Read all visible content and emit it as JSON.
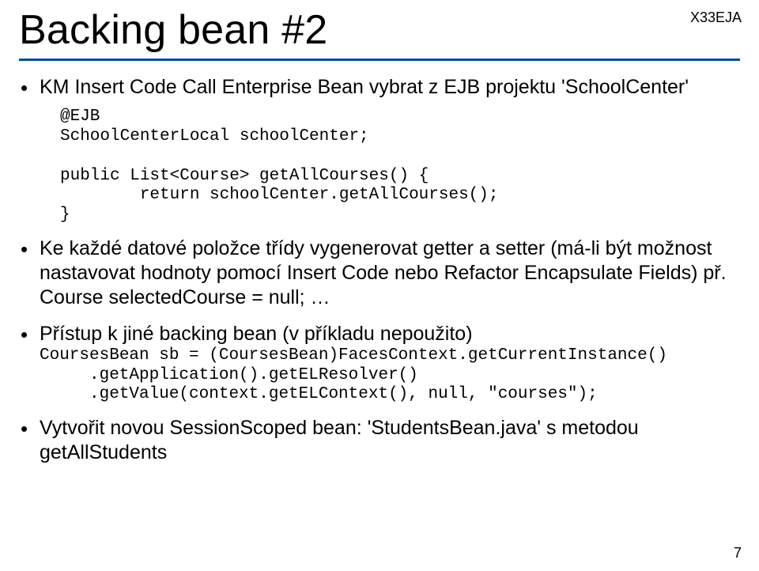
{
  "tag": "X33EJA",
  "title": "Backing bean #2",
  "page_number": "7",
  "bullets": {
    "b1": {
      "text": "KM Insert Code Call Enterprise Bean vybrat z EJB projektu 'SchoolCenter'",
      "code": "@EJB\nSchoolCenterLocal schoolCenter;\n\npublic List<Course> getAllCourses() {\n        return schoolCenter.getAllCourses();\n}"
    },
    "b2": {
      "text": "Ke každé datové položce třídy vygenerovat getter a setter (má-li být možnost nastavovat hodnoty pomocí Insert Code nebo Refactor Encapsulate Fields) př. Course selectedCourse = null; …"
    },
    "b3": {
      "text": "Přístup k jiné backing bean (v příkladu nepoužito)",
      "code": "CoursesBean sb = (CoursesBean)FacesContext.getCurrentInstance()\n     .getApplication().getELResolver()\n     .getValue(context.getELContext(), null, \"courses\");"
    },
    "b4": {
      "text": "Vytvořit novou SessionScoped bean: 'StudentsBean.java' s metodou getAllStudents"
    }
  }
}
